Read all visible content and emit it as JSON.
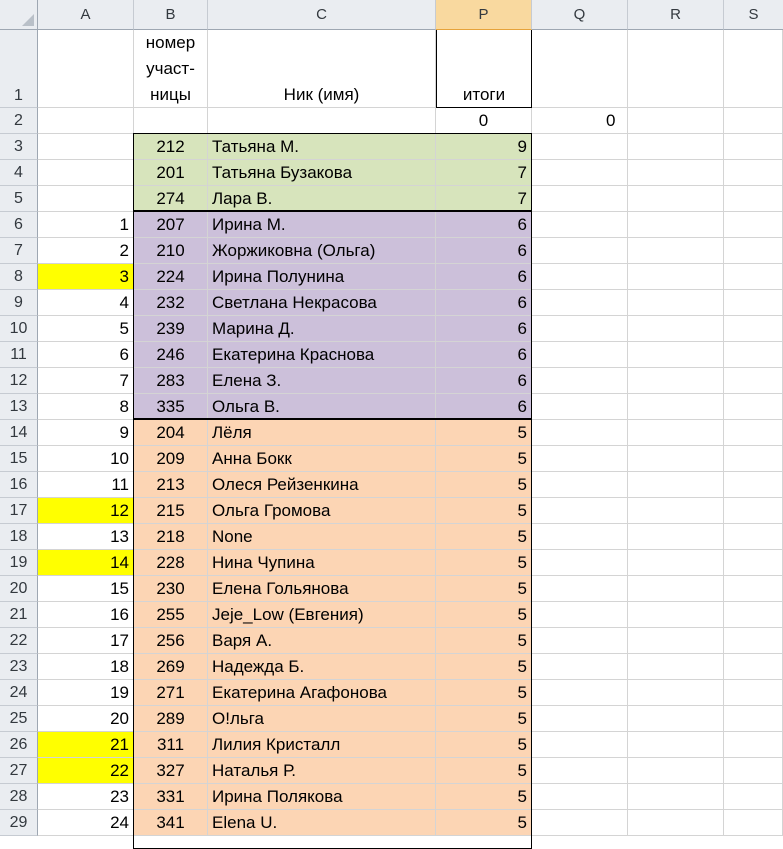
{
  "columns": [
    "A",
    "B",
    "C",
    "P",
    "Q",
    "R",
    "S"
  ],
  "selected_column": "P",
  "colors": {
    "green": "#d7e4bc",
    "purple": "#ccc0da",
    "orange": "#fcd5b4",
    "yellow_highlight": "#ffff00",
    "header_bg": "#eaedf1",
    "selected_header_bg": "#f9d99f"
  },
  "header_row": {
    "row_num": "1",
    "b_lines": [
      "номер",
      "участ-",
      "ницы"
    ],
    "c": "Ник (имя)",
    "p": "итоги"
  },
  "row2": {
    "row_num": "2",
    "p": "0",
    "q": "0"
  },
  "rows": [
    {
      "n": "3",
      "a": "",
      "b": "212",
      "c": "Татьяна М.",
      "p": "9",
      "group": "green",
      "hl": false
    },
    {
      "n": "4",
      "a": "",
      "b": "201",
      "c": "Татьяна Бузакова",
      "p": "7",
      "group": "green",
      "hl": false
    },
    {
      "n": "5",
      "a": "",
      "b": "274",
      "c": "Лара В.",
      "p": "7",
      "group": "green",
      "hl": false
    },
    {
      "n": "6",
      "a": "1",
      "b": "207",
      "c": "Ирина М.",
      "p": "6",
      "group": "purple",
      "hl": false
    },
    {
      "n": "7",
      "a": "2",
      "b": "210",
      "c": "Жоржиковна (Ольга)",
      "p": "6",
      "group": "purple",
      "hl": false
    },
    {
      "n": "8",
      "a": "3",
      "b": "224",
      "c": "Ирина Полунина",
      "p": "6",
      "group": "purple",
      "hl": true
    },
    {
      "n": "9",
      "a": "4",
      "b": "232",
      "c": "Светлана Некрасова",
      "p": "6",
      "group": "purple",
      "hl": false
    },
    {
      "n": "10",
      "a": "5",
      "b": "239",
      "c": "Марина Д.",
      "p": "6",
      "group": "purple",
      "hl": false
    },
    {
      "n": "11",
      "a": "6",
      "b": "246",
      "c": "Екатерина Краснова",
      "p": "6",
      "group": "purple",
      "hl": false
    },
    {
      "n": "12",
      "a": "7",
      "b": "283",
      "c": "Елена З.",
      "p": "6",
      "group": "purple",
      "hl": false
    },
    {
      "n": "13",
      "a": "8",
      "b": "335",
      "c": "Ольга В.",
      "p": "6",
      "group": "purple",
      "hl": false
    },
    {
      "n": "14",
      "a": "9",
      "b": "204",
      "c": "Лёля",
      "p": "5",
      "group": "orange",
      "hl": false
    },
    {
      "n": "15",
      "a": "10",
      "b": "209",
      "c": "Анна Бокк",
      "p": "5",
      "group": "orange",
      "hl": false
    },
    {
      "n": "16",
      "a": "11",
      "b": "213",
      "c": "Олеся Рейзенкина",
      "p": "5",
      "group": "orange",
      "hl": false
    },
    {
      "n": "17",
      "a": "12",
      "b": "215",
      "c": "Ольга Громова",
      "p": "5",
      "group": "orange",
      "hl": true
    },
    {
      "n": "18",
      "a": "13",
      "b": "218",
      "c": "None",
      "p": "5",
      "group": "orange",
      "hl": false
    },
    {
      "n": "19",
      "a": "14",
      "b": "228",
      "c": "Нина Чупина",
      "p": "5",
      "group": "orange",
      "hl": true
    },
    {
      "n": "20",
      "a": "15",
      "b": "230",
      "c": "Елена Гольянова",
      "p": "5",
      "group": "orange",
      "hl": false
    },
    {
      "n": "21",
      "a": "16",
      "b": "255",
      "c": "Jeje_Low (Евгения)",
      "p": "5",
      "group": "orange",
      "hl": false
    },
    {
      "n": "22",
      "a": "17",
      "b": "256",
      "c": "Варя А.",
      "p": "5",
      "group": "orange",
      "hl": false
    },
    {
      "n": "23",
      "a": "18",
      "b": "269",
      "c": "Надежда Б.",
      "p": "5",
      "group": "orange",
      "hl": false
    },
    {
      "n": "24",
      "a": "19",
      "b": "271",
      "c": "Екатерина Агафонова",
      "p": "5",
      "group": "orange",
      "hl": false
    },
    {
      "n": "25",
      "a": "20",
      "b": "289",
      "c": "О!льга",
      "p": "5",
      "group": "orange",
      "hl": false
    },
    {
      "n": "26",
      "a": "21",
      "b": "311",
      "c": "Лилия Кристалл",
      "p": "5",
      "group": "orange",
      "hl": true
    },
    {
      "n": "27",
      "a": "22",
      "b": "327",
      "c": "Наталья Р.",
      "p": "5",
      "group": "orange",
      "hl": true
    },
    {
      "n": "28",
      "a": "23",
      "b": "331",
      "c": "Ирина Полякова",
      "p": "5",
      "group": "orange",
      "hl": false
    },
    {
      "n": "29",
      "a": "24",
      "b": "341",
      "c": "Elena U.",
      "p": "5",
      "group": "orange",
      "hl": false
    }
  ]
}
